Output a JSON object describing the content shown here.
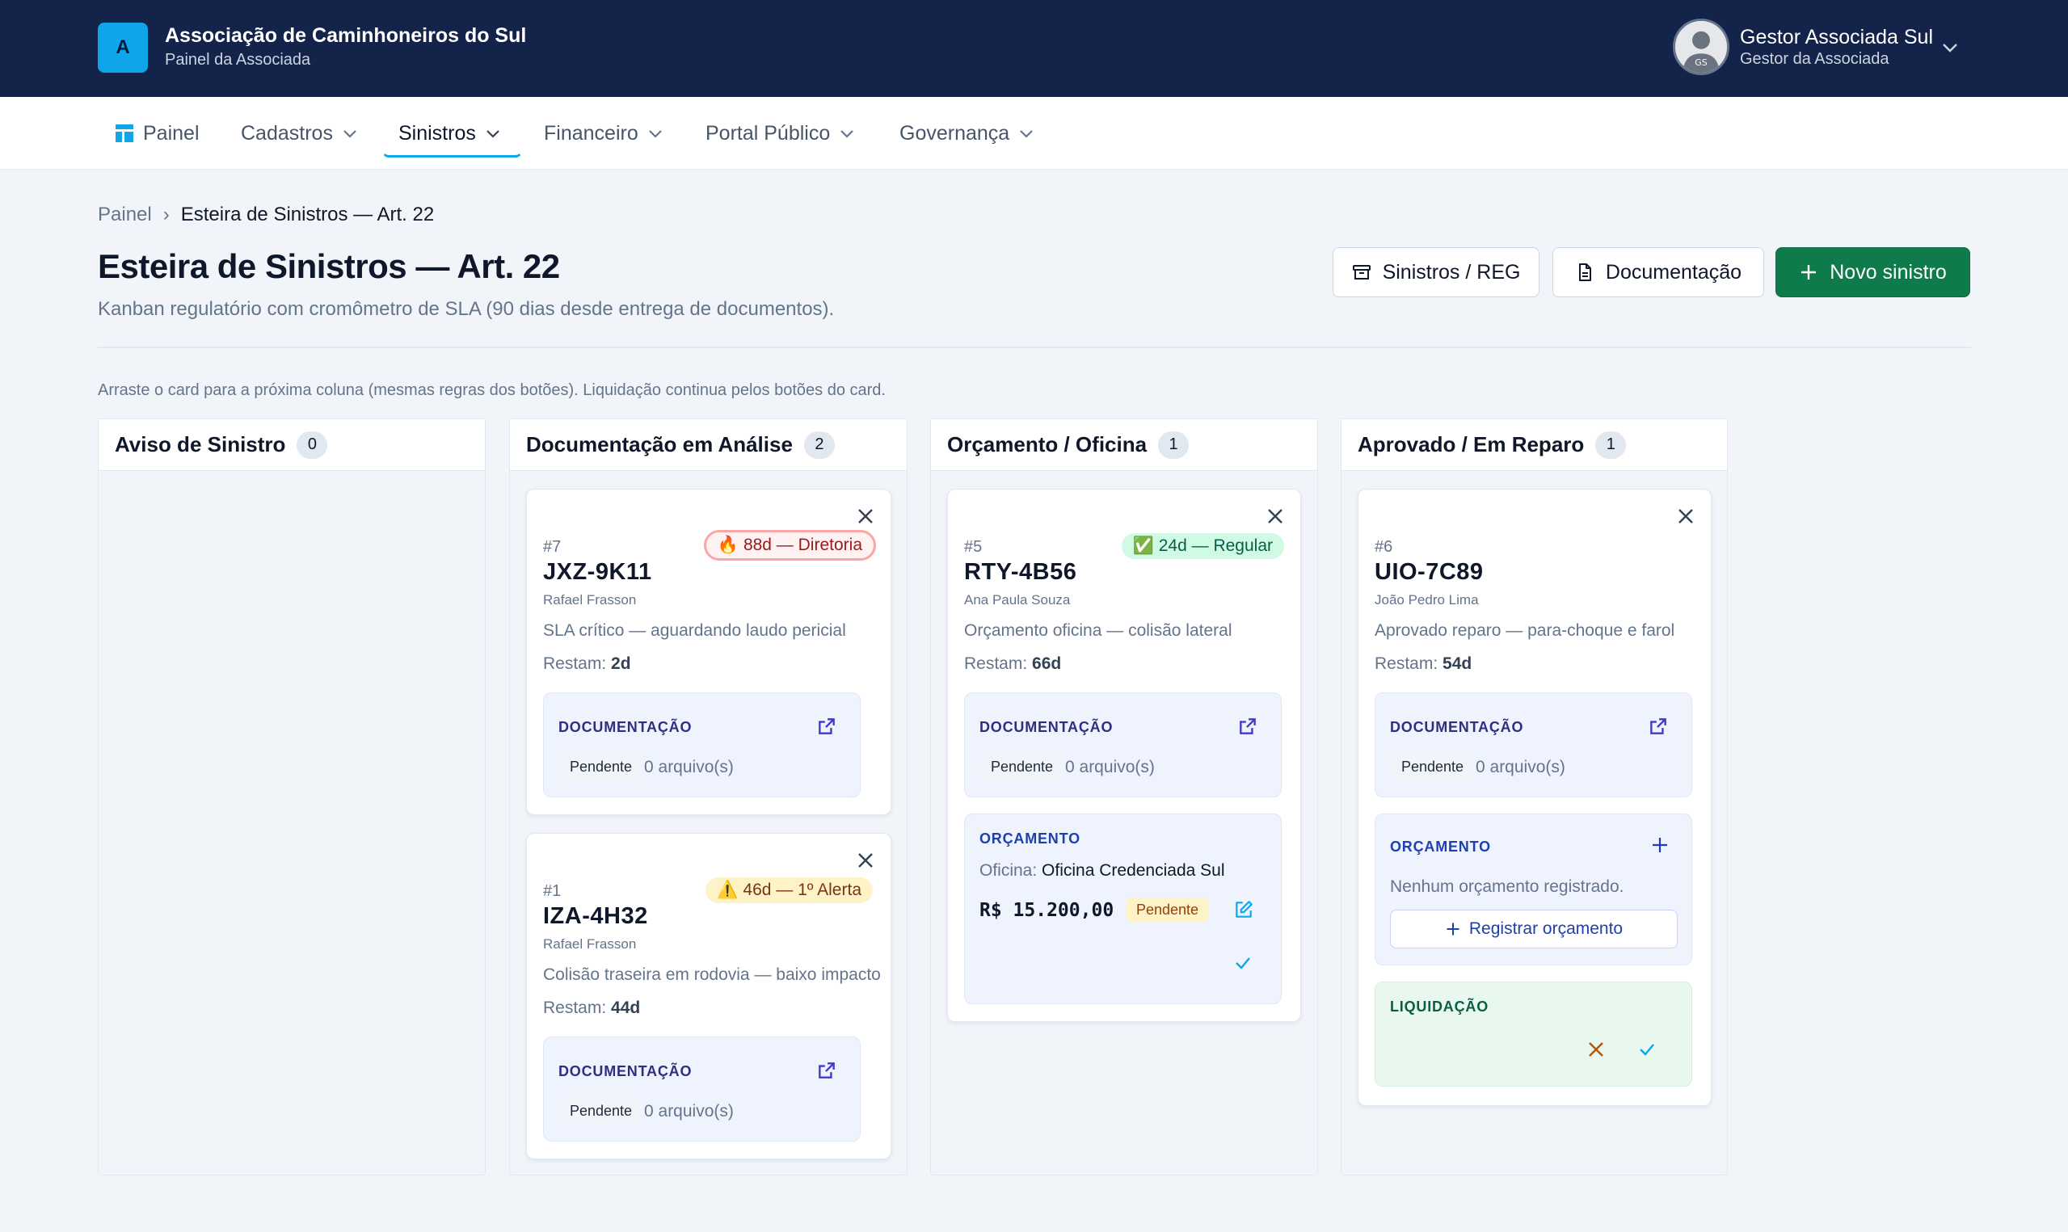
{
  "header": {
    "logo_letter": "A",
    "org_name": "Associação de Caminhoneiros do Sul",
    "org_sub": "Painel da Associada",
    "avatar_initials": "GS",
    "user_name": "Gestor Associada Sul",
    "user_role": "Gestor da Associada"
  },
  "nav": {
    "painel": "Painel",
    "cadastros": "Cadastros",
    "sinistros": "Sinistros",
    "financeiro": "Financeiro",
    "portal": "Portal Público",
    "governanca": "Governança"
  },
  "breadcrumb": {
    "root": "Painel",
    "sep": "›",
    "current": "Esteira de Sinistros — Art. 22"
  },
  "page": {
    "title": "Esteira de Sinistros — Art. 22",
    "subtitle": "Kanban regulatório com cromômetro de SLA (90 dias desde entrega de documentos).",
    "hint": "Arraste o card para a próxima coluna (mesmas regras dos botões). Liquidação continua pelos botões do card."
  },
  "actions": {
    "sinistros_reg": "Sinistros / REG",
    "documentacao": "Documentação",
    "novo": "Novo sinistro"
  },
  "columns": [
    {
      "title": "Aviso de Sinistro",
      "count": "0"
    },
    {
      "title": "Documentação em Análise",
      "count": "2"
    },
    {
      "title": "Orçamento / Oficina",
      "count": "1"
    },
    {
      "title": "Aprovado / Em Reparo",
      "count": "1"
    }
  ],
  "labels": {
    "documentacao": "DOCUMENTAÇÃO",
    "orcamento": "ORÇAMENTO",
    "liquidacao": "LIQUIDAÇÃO",
    "pendente": "Pendente",
    "arquivos": "0 arquivo(s)",
    "restam": "Restam:",
    "oficina_label": "Oficina:",
    "nenhum": "Nenhum orçamento registrado.",
    "registrar": "Registrar orçamento"
  },
  "cards": [
    {
      "num": "#7",
      "plate": "JXZ-9K11",
      "owner": "Rafael Frasson",
      "badge_icon": "🔥",
      "badge": "88d — Diretoria",
      "desc": "SLA crítico — aguardando laudo pericial",
      "restam": "2d"
    },
    {
      "num": "#1",
      "plate": "IZA-4H32",
      "owner": "Rafael Frasson",
      "badge_icon": "⚠️",
      "badge": "46d — 1º Alerta",
      "desc": "Colisão traseira em rodovia — baixo impacto",
      "restam": "44d"
    },
    {
      "num": "#5",
      "plate": "RTY-4B56",
      "owner": "Ana Paula Souza",
      "badge_icon": "✅",
      "badge": "24d — Regular",
      "desc": "Orçamento oficina — colisão lateral",
      "restam": "66d",
      "oficina": "Oficina Credenciada Sul",
      "valor": "R$ 15.200,00",
      "status": "Pendente"
    },
    {
      "num": "#6",
      "plate": "UIO-7C89",
      "owner": "João Pedro Lima",
      "desc": "Aprovado reparo — para-choque e farol",
      "restam": "54d"
    }
  ],
  "colors": {
    "topbar": "#13234a",
    "accent": "#0ea5e9",
    "primary": "#0f7a4a"
  }
}
